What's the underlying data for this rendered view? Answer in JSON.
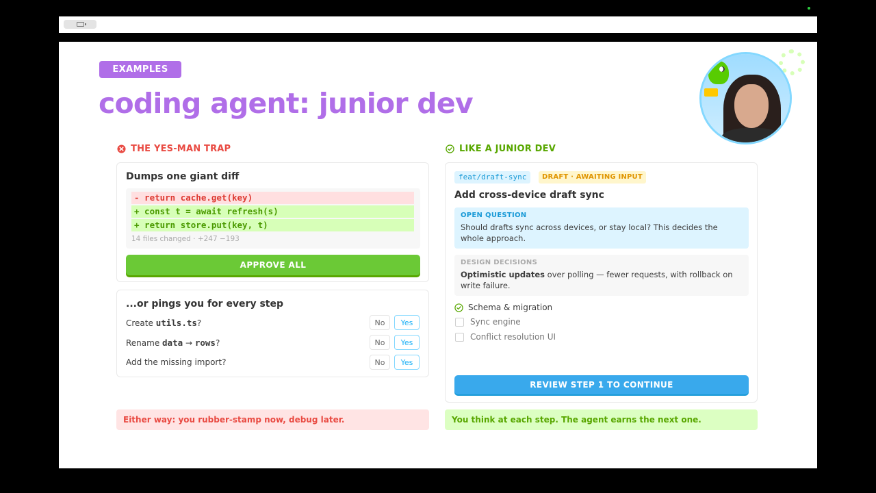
{
  "slide": {
    "badge": "EXAMPLES",
    "title": "coding agent: junior dev"
  },
  "left": {
    "heading": "THE YES-MAN TRAP",
    "diff_card": {
      "title": "Dumps one giant diff",
      "lines": [
        "- return cache.get(key)",
        "+ const t = await refresh(s)",
        "+ return store.put(key, t)"
      ],
      "stats": "14 files changed · +247 −193",
      "approve_label": "APPROVE ALL"
    },
    "steps_card": {
      "title": "...or pings you for every step",
      "rows": [
        {
          "pre": "Create ",
          "code": "utils.ts",
          "post": "?"
        },
        {
          "pre": "Rename ",
          "code": "data",
          "arrow": " → ",
          "code2": "rows",
          "post": "?"
        },
        {
          "pre": "Add the missing import?"
        }
      ],
      "no_label": "No",
      "yes_label": "Yes"
    },
    "footer": "Either way: you rubber-stamp now, debug later."
  },
  "right": {
    "heading": "LIKE A JUNIOR DEV",
    "branch": "feat/draft-sync",
    "status": "DRAFT · AWAITING INPUT",
    "title": "Add cross-device draft sync",
    "open_question": {
      "kicker": "OPEN QUESTION",
      "text": "Should drafts sync across devices, or stay local? This decides the whole approach."
    },
    "design": {
      "kicker": "DESIGN DECISIONS",
      "bold": "Optimistic updates",
      "rest": " over polling — fewer requests, with rollback on write failure."
    },
    "checklist": [
      {
        "label": "Schema & migration",
        "done": true
      },
      {
        "label": "Sync engine",
        "done": false
      },
      {
        "label": "Conflict resolution UI",
        "done": false
      }
    ],
    "review_label": "REVIEW STEP 1 TO CONTINUE",
    "footer": "You think at each step. The agent earns the next one."
  },
  "colors": {
    "purple": "#b06ee8",
    "red": "#e94b43",
    "green": "#58a700",
    "blue": "#1cb0f6"
  }
}
